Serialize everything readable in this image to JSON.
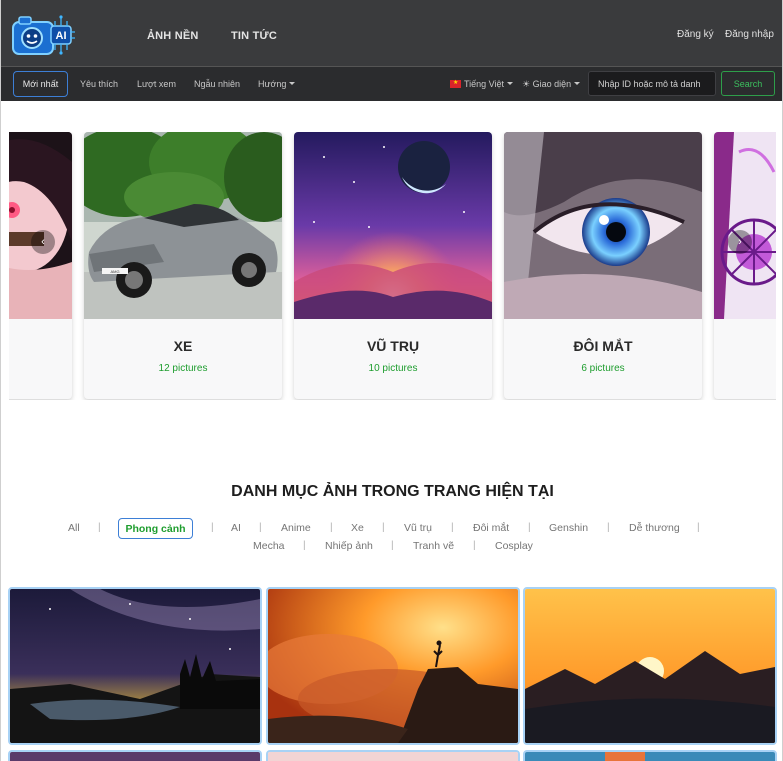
{
  "header": {
    "nav": [
      "ẢNH NỀN",
      "TIN TỨC"
    ],
    "register": "Đăng ký",
    "login": "Đăng nhập"
  },
  "subnav": {
    "items": [
      "Mới nhất",
      "Yêu thích",
      "Lượt xem",
      "Ngẫu nhiên",
      "Hướng"
    ],
    "language": "Tiếng Việt",
    "theme": "Giao diện",
    "search_placeholder": "Nhập ID hoặc mô tả danh",
    "search_button": "Search"
  },
  "carousel": {
    "cards": [
      {
        "title": "XE",
        "count": "12 pictures"
      },
      {
        "title": "VŨ TRỤ",
        "count": "10 pictures"
      },
      {
        "title": "ĐÔI MẮT",
        "count": "6 pictures"
      }
    ]
  },
  "section": {
    "title": "DANH MỤC ẢNH TRONG TRANG HIỆN TẠI",
    "filters": [
      "All",
      "Phong cảnh",
      "AI",
      "Anime",
      "Xe",
      "Vũ trụ",
      "Đôi mắt",
      "Genshin",
      "Dễ thương",
      "Mecha",
      "Nhiếp ảnh",
      "Tranh vẽ",
      "Cosplay"
    ],
    "active_filter": "Phong cảnh"
  },
  "colors": {
    "header_bg": "#3a3b3d",
    "subnav_bg": "#2b2c2e",
    "accent_blue": "#3d7fd6",
    "accent_green": "#1e9d2e"
  },
  "icons": [
    "ai-camera-logo",
    "sun-icon",
    "chevron-left-icon",
    "chevron-right-icon",
    "vietnam-flag-icon"
  ]
}
